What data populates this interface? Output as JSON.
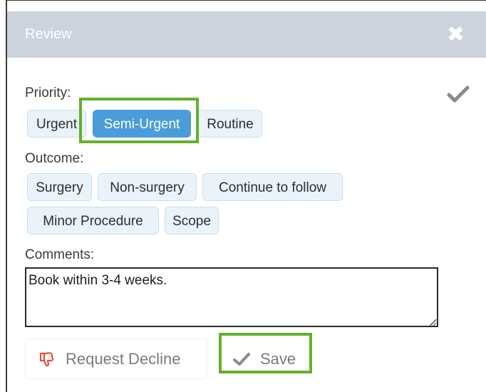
{
  "dialog": {
    "title": "Review",
    "close_icon": "close-x-icon"
  },
  "priority": {
    "label": "Priority:",
    "options": [
      "Urgent",
      "Semi-Urgent",
      "Routine"
    ],
    "selected": "Semi-Urgent"
  },
  "outcome": {
    "label": "Outcome:",
    "options": [
      "Surgery",
      "Non-surgery",
      "Continue to follow",
      "Minor Procedure",
      "Scope"
    ]
  },
  "comments": {
    "label": "Comments:",
    "value": "Book within 3-4 weeks."
  },
  "actions": {
    "decline_label": "Request Decline",
    "decline_icon": "thumbs-down-icon",
    "save_label": "Save",
    "save_icon": "checkmark-icon"
  },
  "colors": {
    "header_bg": "#ccd3dc",
    "selected_pill": "#4a9dd9",
    "pill_bg": "#eaf3f9",
    "highlight_border": "#63b12b",
    "decline_icon": "#e8503a"
  }
}
